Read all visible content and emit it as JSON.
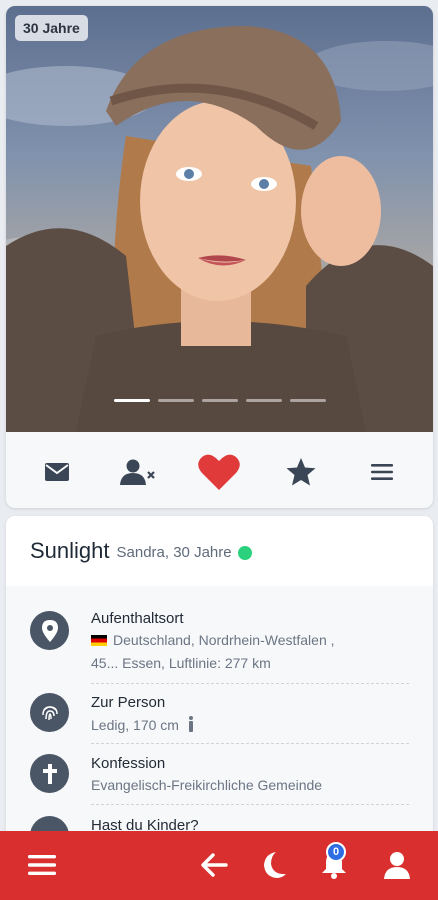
{
  "profile": {
    "age_badge": "30 Jahre",
    "photo_count": 5,
    "photo_active_index": 0,
    "username": "Sunlight",
    "subtitle": "Sandra, 30 Jahre",
    "online": true
  },
  "actions": [
    {
      "name": "message-button",
      "icon": "envelope-icon"
    },
    {
      "name": "block-user-button",
      "icon": "user-x-icon"
    },
    {
      "name": "like-button",
      "icon": "heart-icon"
    },
    {
      "name": "favorite-button",
      "icon": "star-icon"
    },
    {
      "name": "more-menu-button",
      "icon": "hamburger-icon"
    }
  ],
  "details": [
    {
      "label": "Aufenthaltsort",
      "line1": "Deutschland, Nordrhein-Westfalen ,",
      "line2": "45... Essen,  Luftlinie: 277 km",
      "icon": "map-pin-icon"
    },
    {
      "label": "Zur Person",
      "value": "Ledig, 170 cm",
      "icon": "fingerprint-icon"
    },
    {
      "label": "Konfession",
      "value": "Evangelisch-Freikirchliche Gemeinde",
      "icon": "cross-icon"
    },
    {
      "label": "Hast du Kinder?",
      "icon": "children-icon"
    }
  ],
  "bottom_nav": {
    "notification_count": "0"
  },
  "colors": {
    "accent_red": "#d9302f",
    "heart_red": "#e03a3a",
    "online_green": "#2bd17c",
    "badge_blue": "#2f6de5",
    "icon_dark": "#3a4656"
  }
}
